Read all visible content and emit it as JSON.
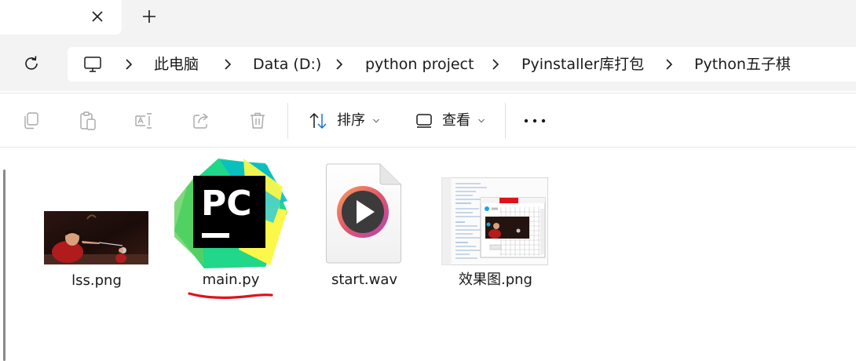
{
  "tabs": {
    "close_icon": "close-icon",
    "new_tab_icon": "plus-icon"
  },
  "address": {
    "refresh_icon": "refresh-icon",
    "root_icon": "this-pc-icon",
    "breadcrumbs": [
      "此电脑",
      "Data (D:)",
      "python project",
      "Pyinstaller库打包",
      "Python五子棋"
    ]
  },
  "toolbar": {
    "copy_icon": "copy-icon",
    "paste_icon": "paste-icon",
    "rename_icon": "rename-icon",
    "share_icon": "share-icon",
    "delete_icon": "delete-icon",
    "sort_label": "排序",
    "view_label": "查看",
    "more_icon": "more-icon"
  },
  "files": [
    {
      "name": "lss.png",
      "icon": "image-thumbnail"
    },
    {
      "name": "main.py",
      "icon": "pycharm-icon",
      "logo_text": "PC"
    },
    {
      "name": "start.wav",
      "icon": "media-file-icon"
    },
    {
      "name": "效果图.png",
      "icon": "image-thumbnail"
    }
  ],
  "annotation": {
    "color": "#e0121a"
  },
  "colors": {
    "accent": "#1a73c8",
    "chrome": "#f3f3f3"
  }
}
